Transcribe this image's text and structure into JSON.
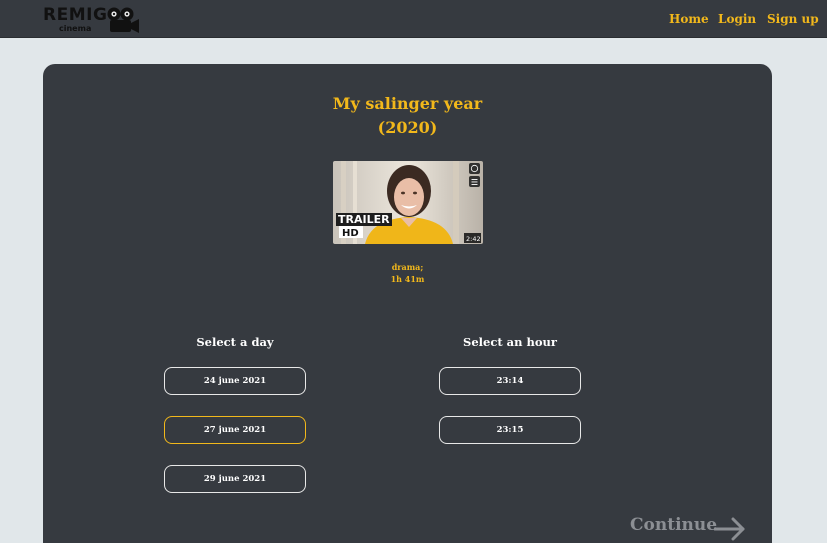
{
  "brand": {
    "name": "REMIG",
    "subtitle": "cinema"
  },
  "nav": {
    "home": "Home",
    "login": "Login",
    "signup": "Sign up"
  },
  "movie": {
    "title_line1": "My salinger year",
    "title_line2": "(2020)",
    "genre": "drama;",
    "duration": "1h 41m",
    "trailer": {
      "badge_line1": "TRAILER",
      "badge_line2": "HD",
      "length": "2:42"
    }
  },
  "days": {
    "heading": "Select a day",
    "options": [
      "24 june 2021",
      "27 june 2021",
      "29 june 2021"
    ],
    "selected_index": 1
  },
  "hours": {
    "heading": "Select an hour",
    "options": [
      "23:14",
      "23:15"
    ]
  },
  "actions": {
    "continue_label": "Continue"
  },
  "colors": {
    "accent": "#f2b81b",
    "panel": "#363a40",
    "page_bg": "#e1e7ea",
    "muted": "#8c8f94"
  }
}
